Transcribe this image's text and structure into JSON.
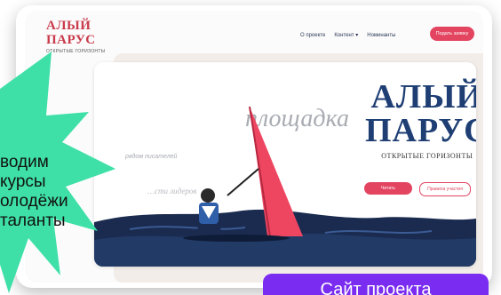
{
  "header": {
    "logo": {
      "line1": "АЛЫЙ",
      "line2": "ПАРУС",
      "line3": "ОТКРЫТЫЕ ГОРИЗОНТЫ"
    },
    "nav": [
      "О проекте",
      "Контент",
      "Номинанты"
    ],
    "cta": "Подать заявку"
  },
  "hero": {
    "brand": {
      "line1": "АЛЫЙ",
      "line2": "ПАРУС",
      "line3": "ОТКРЫТЫЕ ГОРИЗОНТЫ"
    },
    "buttons": {
      "read": "Читать",
      "rules": "Правила участия"
    },
    "handwriting": "площадка",
    "faint_lines": [
      "рядом писателей",
      "…сти лидеров"
    ]
  },
  "promo": {
    "lines": [
      "водим",
      "курсы",
      "олодёжи",
      "таланты"
    ],
    "colors": {
      "burst": "#3ee0a8"
    }
  },
  "footer": {
    "site_button": "Сайт проекта"
  }
}
